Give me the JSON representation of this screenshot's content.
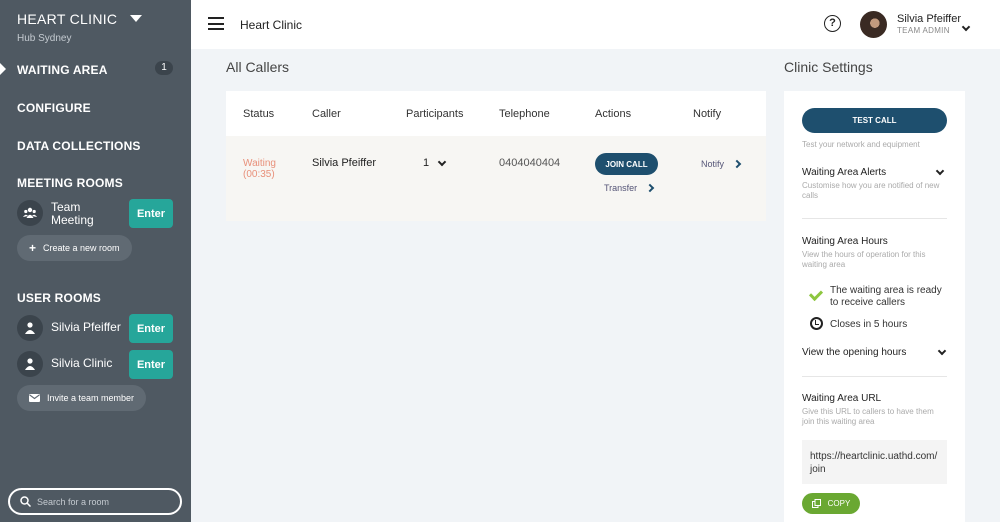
{
  "sidebar": {
    "clinic_name": "HEART CLINIC",
    "clinic_location": "Hub Sydney",
    "nav": {
      "waiting_area": "WAITING AREA",
      "waiting_count": "1",
      "configure": "CONFIGURE",
      "data_collections": "DATA COLLECTIONS",
      "meeting_rooms": "MEETING ROOMS",
      "user_rooms": "USER ROOMS"
    },
    "meeting_rooms": [
      {
        "label": "Team Meeting",
        "enter_label": "Enter",
        "icon": "group-icon"
      }
    ],
    "create_room_label": "Create a new room",
    "user_rooms": [
      {
        "label": "Silvia Pfeiffer",
        "enter_label": "Enter",
        "icon": "person-icon"
      },
      {
        "label": "Silvia Clinic",
        "enter_label": "Enter",
        "icon": "person-icon"
      }
    ],
    "invite_label": "Invite a team member",
    "search_placeholder": "Search for a room"
  },
  "topbar": {
    "title": "Heart Clinic",
    "user_name": "Silvia Pfeiffer",
    "user_role": "TEAM ADMIN"
  },
  "callers": {
    "title": "All Callers",
    "columns": [
      "Status",
      "Caller",
      "Participants",
      "Telephone",
      "Actions",
      "Notify"
    ],
    "rows": [
      {
        "status": "Waiting",
        "wait_time": "(00:35)",
        "caller": "Silvia Pfeiffer",
        "participants": "1",
        "telephone": "0404040404",
        "join_label": "JOIN CALL",
        "transfer_label": "Transfer",
        "notify_label": "Notify"
      }
    ]
  },
  "settings": {
    "title": "Clinic Settings",
    "test_call_label": "TEST CALL",
    "test_call_help": "Test your network and equipment",
    "alerts_title": "Waiting Area Alerts",
    "alerts_help": "Customise how you are notified of new calls",
    "hours_title": "Waiting Area Hours",
    "hours_help": "View the hours of operation for this waiting area",
    "ready_status": "The waiting area is ready to receive callers",
    "closes_status": "Closes in 5 hours",
    "opening_hours_label": "View the opening hours",
    "url_title": "Waiting Area URL",
    "url_help": "Give this URL to callers to have them join this waiting area",
    "url_value": "https://heartclinic.uathd.com/join",
    "copy_label": "COPY"
  },
  "colors": {
    "sidebar_bg": "#4f5962",
    "accent_teal": "#26a69a",
    "primary_navy": "#1e4f6e",
    "waiting_text": "#e8907a",
    "copy_green": "#6aa832",
    "check_green": "#8dc63f"
  }
}
